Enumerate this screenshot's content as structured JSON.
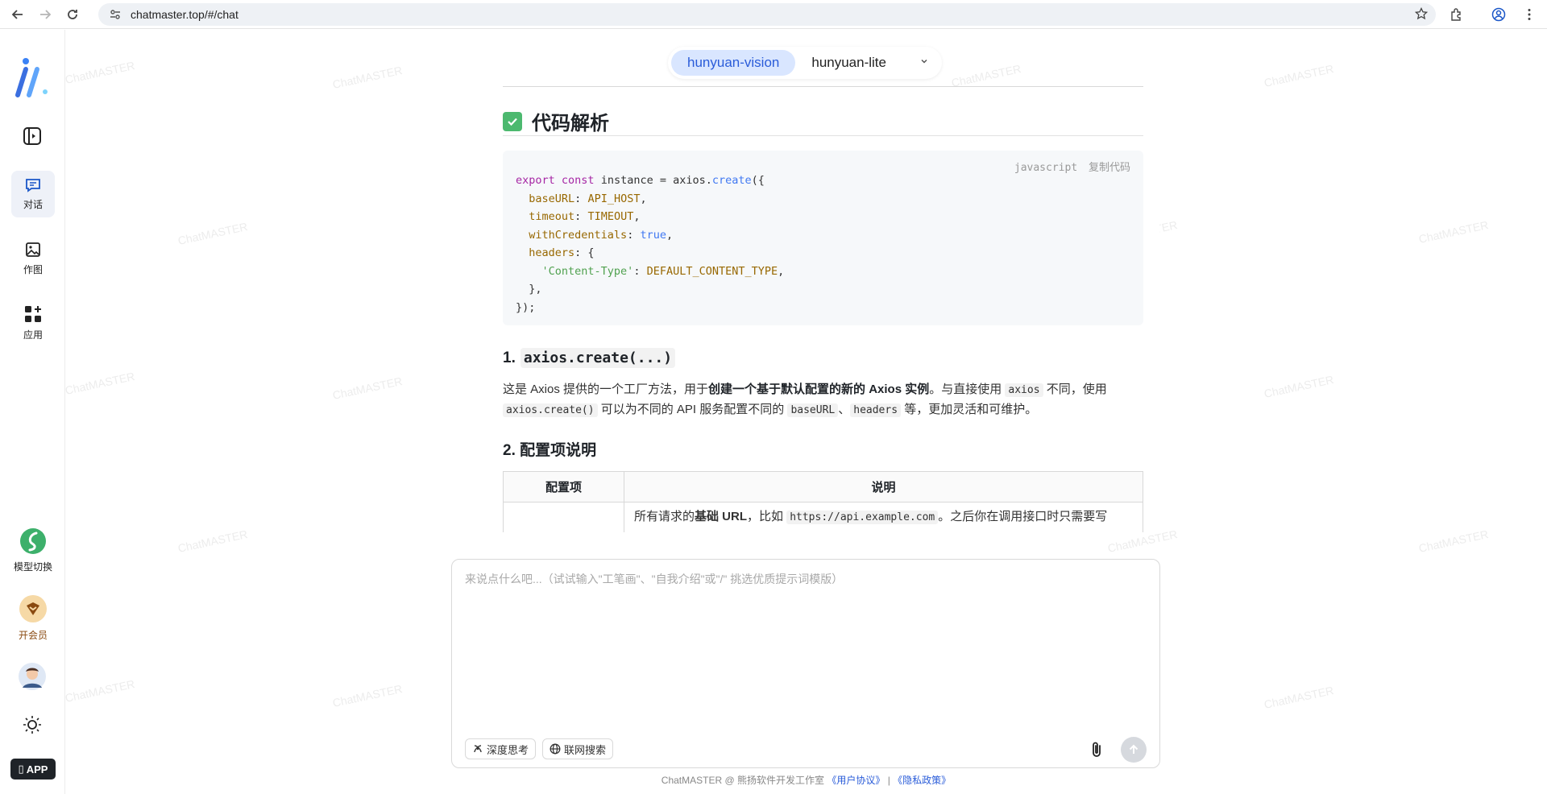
{
  "browser": {
    "url": "chatmaster.top/#/chat"
  },
  "sidebar": {
    "items": [
      {
        "label": "对话"
      },
      {
        "label": "作图"
      },
      {
        "label": "应用"
      }
    ],
    "model_switch_label": "模型切换",
    "vip_label": "开会员",
    "app_label": "APP"
  },
  "watermark": "ChatMASTER",
  "models": {
    "active": "hunyuan-vision",
    "other": "hunyuan-lite"
  },
  "content": {
    "section_title": "代码解析",
    "code": {
      "lang": "javascript",
      "copy_label": "复制代码",
      "lines": [
        "export const instance = axios.create({",
        "  baseURL: API_HOST,",
        "  timeout: TIMEOUT,",
        "  withCredentials: true,",
        "  headers: {",
        "    'Content-Type': DEFAULT_CONTENT_TYPE,",
        "  },",
        "});"
      ]
    },
    "h1_num": "1.",
    "h1_code": "axios.create(...)",
    "para": {
      "p1": "这是 Axios 提供的一个工厂方法，用于",
      "p1_bold": "创建一个基于默认配置的新的 Axios 实例",
      "p1_rest": "。与直接使用",
      "c1": "axios",
      "p2": "不同，使用",
      "c2": "axios.create()",
      "p3": "可以为不同的 API 服务配置不同的",
      "c3": "baseURL",
      "p4": "、",
      "c4": "headers",
      "p5": "等，更加灵活和可维护。"
    },
    "h2": "2. 配置项说明",
    "table": {
      "col1": "配置项",
      "col2": "说明",
      "row1_prefix": "所有请求的",
      "row1_bold": "基础 URL",
      "row1_mid": "，比如",
      "row1_code": "https://api.example.com",
      "row1_rest": "。之后你在调用接口时只需要写"
    }
  },
  "input": {
    "placeholder": "来说点什么吧...（试试输入\"工笔画\"、\"自我介绍\"或\"/\" 挑选优质提示词模版）",
    "deep_think": "深度思考",
    "web_search": "联网搜索"
  },
  "footer": {
    "text": "ChatMASTER @ 熊扬软件开发工作室",
    "terms": "《用户协议》",
    "sep": "|",
    "privacy": "《隐私政策》"
  }
}
